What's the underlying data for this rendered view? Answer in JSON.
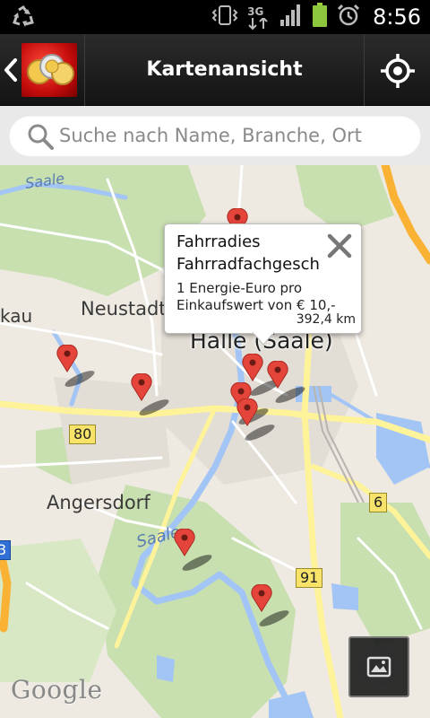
{
  "status_bar": {
    "time": "8:56",
    "network_label": "3G",
    "icons": [
      "recycle-icon",
      "vibrate-icon",
      "3g-data-icon",
      "signal-icon",
      "battery-icon",
      "alarm-icon"
    ]
  },
  "header": {
    "title": "Kartenansicht",
    "back_icon": "chevron-left-icon",
    "logo": "app-logo-coins",
    "locate_icon": "my-location-icon"
  },
  "search": {
    "placeholder": "Suche nach Name, Branche, Ort",
    "value": ""
  },
  "map": {
    "place_labels": [
      "Saale",
      "Neustadt",
      "kau",
      "Halle (Saale)",
      "Angersdorf",
      "Saale"
    ],
    "road_shields": [
      "80",
      "6",
      "91",
      "3"
    ],
    "attribution": "Google",
    "marker_count": 9
  },
  "popup": {
    "name_line1": "Fahrradies",
    "name_line2": "Fahrradfachgesch",
    "desc_line1": "1 Energie-Euro pro",
    "desc_line2": "Einkaufswert von € 10,-",
    "distance": "392,4 km",
    "close_icon": "close-icon"
  },
  "colors": {
    "titlebar": "#1c1c1c",
    "map_background": "#eee9e1",
    "park_green": "#c8dfb0",
    "water_blue": "#a3c5f5",
    "highway_orange": "#f9b233",
    "road_yellow": "#fff39a",
    "marker_red": "#e5443a"
  }
}
